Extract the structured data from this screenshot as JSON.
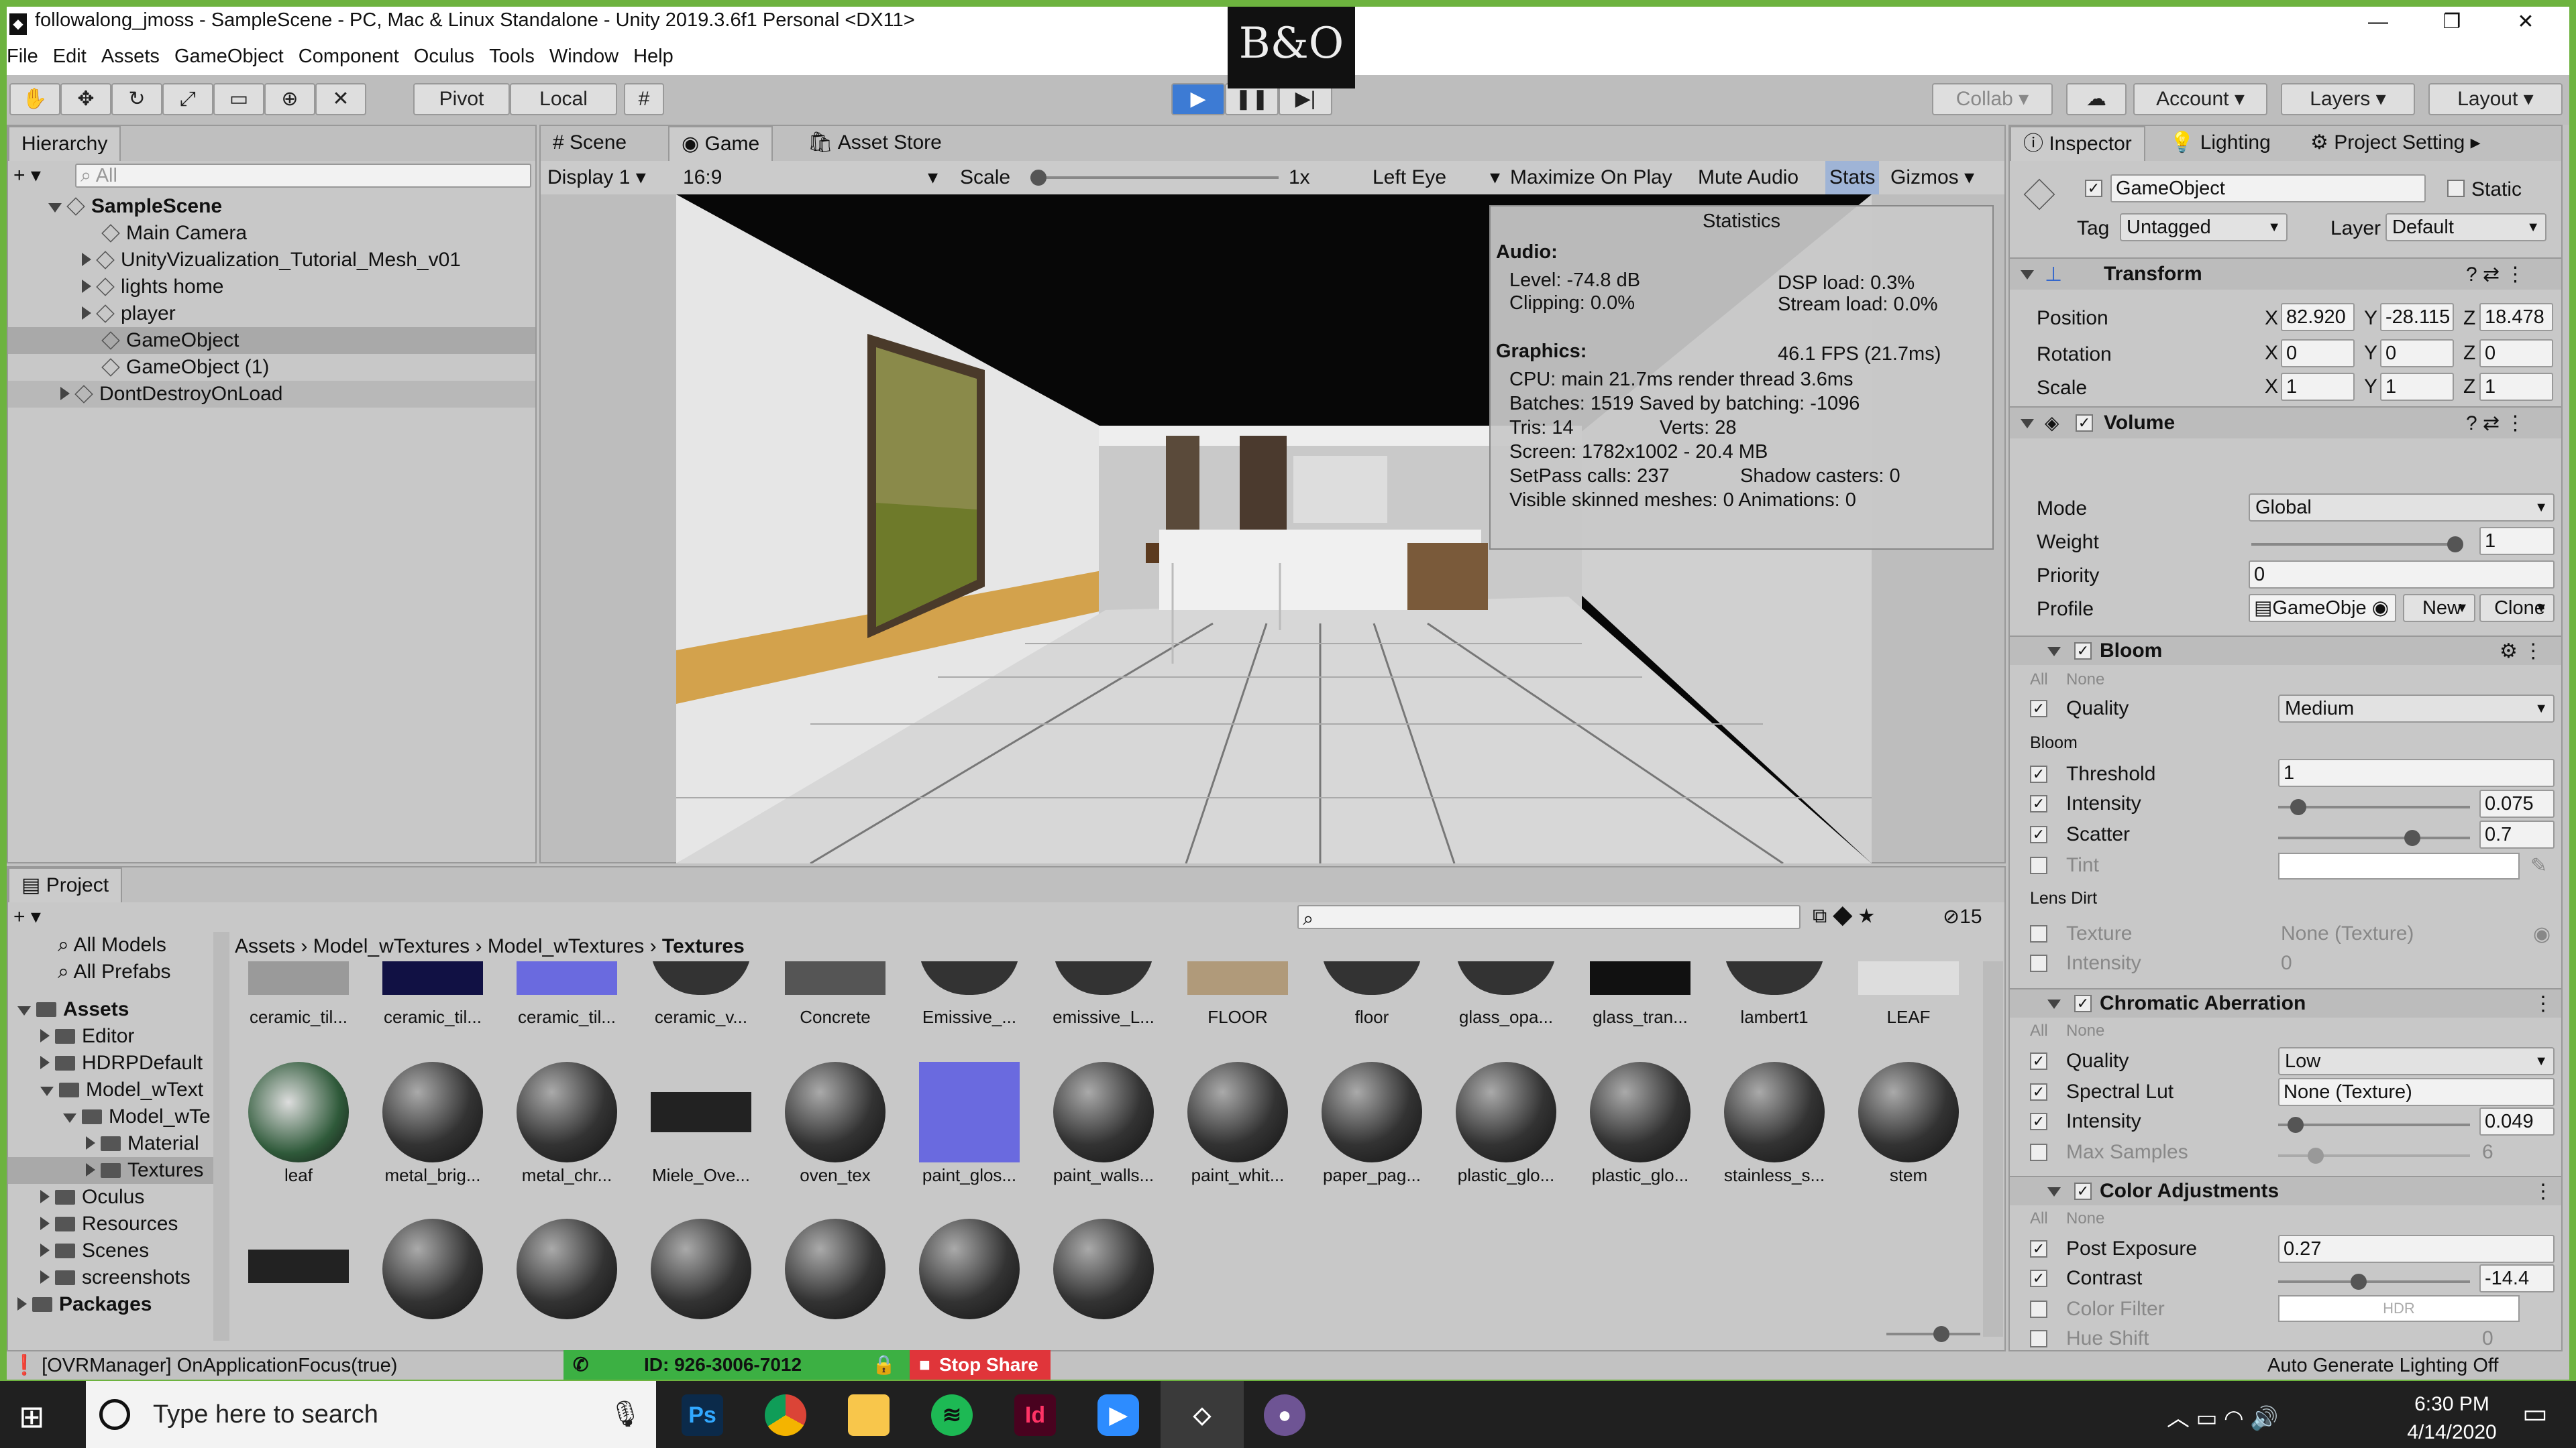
{
  "window": {
    "title": "followalong_jmoss - SampleScene - PC, Mac & Linux Standalone - Unity 2019.3.6f1 Personal <DX11>"
  },
  "menu": [
    "File",
    "Edit",
    "Assets",
    "GameObject",
    "Component",
    "Oculus",
    "Tools",
    "Window",
    "Help"
  ],
  "toolbar": {
    "pivot": "Pivot",
    "local": "Local",
    "collab": "Collab",
    "account": "Account",
    "layers": "Layers",
    "layout": "Layout"
  },
  "hierarchy": {
    "tab": "Hierarchy",
    "search_placeholder": "All",
    "scene": "SampleScene",
    "items": [
      "Main Camera",
      "UnityVizualization_Tutorial_Mesh_v01",
      "lights home",
      "player",
      "GameObject",
      "GameObject (1)"
    ],
    "dontdestroy": "DontDestroyOnLoad"
  },
  "game": {
    "tabs": [
      "Scene",
      "Game",
      "Asset Store"
    ],
    "display": "Display 1",
    "aspect": "16:9",
    "scale_label": "Scale",
    "scale_value": "1x",
    "eye": "Left Eye",
    "maximize": "Maximize On Play",
    "mute": "Mute Audio",
    "stats": "Stats",
    "gizmos": "Gizmos"
  },
  "stats": {
    "title": "Statistics",
    "audio_h": "Audio:",
    "level": "Level: -74.8 dB",
    "dsp": "DSP load: 0.3%",
    "clipping": "Clipping: 0.0%",
    "stream": "Stream load: 0.0%",
    "graphics_h": "Graphics:",
    "fps": "46.1 FPS (21.7ms)",
    "cpu": "CPU: main 21.7ms  render thread 3.6ms",
    "batches": "Batches: 1519  Saved by batching: -1096",
    "tris": "Tris: 14",
    "verts": "Verts: 28",
    "screen": "Screen: 1782x1002 - 20.4 MB",
    "setpass": "SetPass calls: 237",
    "shadow": "Shadow casters: 0",
    "skinned": "Visible skinned meshes: 0  Animations: 0"
  },
  "inspector": {
    "tabs": [
      "Inspector",
      "Lighting",
      "Project Setting"
    ],
    "name": "GameObject",
    "static": "Static",
    "tag_label": "Tag",
    "tag": "Untagged",
    "layer_label": "Layer",
    "layer": "Default",
    "transform": {
      "title": "Transform",
      "position": "Position",
      "rotation": "Rotation",
      "scale": "Scale",
      "px": "82.920",
      "py": "-28.115",
      "pz": "18.478",
      "rx": "0",
      "ry": "0",
      "rz": "0",
      "sx": "1",
      "sy": "1",
      "sz": "1",
      "x": "X",
      "y": "Y",
      "z": "Z"
    },
    "volume": {
      "title": "Volume",
      "mode_l": "Mode",
      "mode": "Global",
      "weight_l": "Weight",
      "weight": "1",
      "priority_l": "Priority",
      "priority": "0",
      "profile_l": "Profile",
      "profile": "GameObje",
      "new": "New",
      "clone": "Clone"
    },
    "all": "All",
    "none": "None",
    "bloom": {
      "title": "Bloom",
      "quality_l": "Quality",
      "quality": "Medium",
      "sub": "Bloom",
      "threshold_l": "Threshold",
      "threshold": "1",
      "intensity_l": "Intensity",
      "intensity": "0.075",
      "scatter_l": "Scatter",
      "scatter": "0.7",
      "tint_l": "Tint",
      "lensdirt": "Lens Dirt",
      "texture_l": "Texture",
      "texture": "None (Texture)",
      "dirt_int_l": "Intensity",
      "dirt_int": "0",
      "intensity_frac": 0.1,
      "scatter_frac": 0.7
    },
    "chromatic": {
      "title": "Chromatic Aberration",
      "quality_l": "Quality",
      "quality": "Low",
      "lut_l": "Spectral Lut",
      "lut": "None (Texture)",
      "intensity_l": "Intensity",
      "intensity": "0.049",
      "max_l": "Max Samples",
      "max": "6"
    },
    "color": {
      "title": "Color Adjustments",
      "exposure_l": "Post Exposure",
      "exposure": "0.27",
      "contrast_l": "Contrast",
      "contrast": "-14.4",
      "filter_l": "Color Filter",
      "filter": "HDR",
      "hue_l": "Hue Shift",
      "hue": "0"
    }
  },
  "project": {
    "tab": "Project",
    "count": "15",
    "favorites": [
      "All Models",
      "All Prefabs"
    ],
    "tree": [
      {
        "label": "Assets",
        "depth": 0
      },
      {
        "label": "Editor",
        "depth": 1
      },
      {
        "label": "HDRPDefault",
        "depth": 1
      },
      {
        "label": "Model_wText",
        "depth": 1
      },
      {
        "label": "Model_wTe",
        "depth": 2
      },
      {
        "label": "Material",
        "depth": 3
      },
      {
        "label": "Textures",
        "depth": 3
      },
      {
        "label": "Oculus",
        "depth": 1
      },
      {
        "label": "Resources",
        "depth": 1
      },
      {
        "label": "Scenes",
        "depth": 1
      },
      {
        "label": "screenshots",
        "depth": 1
      },
      {
        "label": "Packages",
        "depth": 0
      }
    ],
    "breadcrumb": [
      "Assets",
      "Model_wTextures",
      "Model_wTextures",
      "Textures"
    ],
    "row1": [
      "ceramic_til...",
      "ceramic_til...",
      "ceramic_til...",
      "ceramic_v...",
      "Concrete",
      "Emissive_...",
      "emissive_L...",
      "FLOOR",
      "floor",
      "glass_opa...",
      "glass_tran...",
      "lambert1",
      "LEAF"
    ],
    "row2": [
      "leaf",
      "metal_brig...",
      "metal_chr...",
      "Miele_Ove...",
      "oven_tex",
      "paint_glos...",
      "paint_walls...",
      "paint_whit...",
      "paper_pag...",
      "plastic_glo...",
      "plastic_glo...",
      "stainless_s...",
      "stem"
    ]
  },
  "status": {
    "message": "[OVRManager] OnApplicationFocus(true)",
    "lighting": "Auto Generate Lighting Off"
  },
  "zoom": {
    "id": "ID: 926-3006-7012",
    "stop": "Stop Share"
  },
  "taskbar": {
    "search": "Type here to search",
    "time": "6:30 PM",
    "date": "4/14/2020"
  }
}
